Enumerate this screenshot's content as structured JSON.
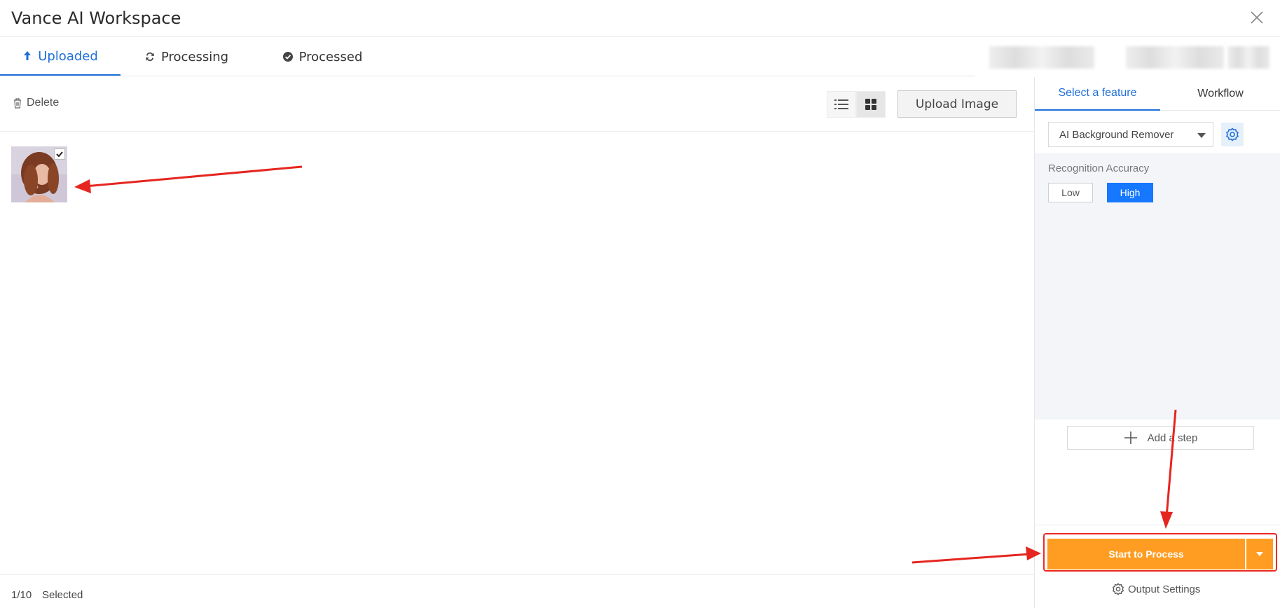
{
  "window": {
    "title": "Vance AI Workspace",
    "close_icon": "close-icon"
  },
  "tabs": [
    {
      "label": "Uploaded",
      "icon": "upload-arrow-icon",
      "active": true
    },
    {
      "label": "Processing",
      "icon": "refresh-icon",
      "active": false
    },
    {
      "label": "Processed",
      "icon": "check-circle-icon",
      "active": false
    }
  ],
  "toolbar": {
    "delete_label": "Delete",
    "upload_label": "Upload Image",
    "view_modes": [
      "list-view-icon",
      "grid-view-icon"
    ],
    "active_view": "grid"
  },
  "gallery": {
    "items": [
      {
        "selected": true,
        "thumbnail": "portrait-photo"
      }
    ]
  },
  "footer": {
    "count": "1/10",
    "selected_label": "Selected"
  },
  "panel": {
    "tabs": [
      "Select a feature",
      "Workflow"
    ],
    "feature_select": {
      "value": "AI Background Remover"
    },
    "accuracy": {
      "label": "Recognition Accuracy",
      "options": [
        "Low",
        "High"
      ],
      "selected": "High"
    },
    "add_step_label": "Add a step",
    "process_label": "Start to Process",
    "output_settings_label": "Output Settings"
  },
  "colors": {
    "accent_blue": "#1e6fd9",
    "selected_option": "#1677ff",
    "process_orange": "#ff9d22",
    "highlight_red": "#ee2a24"
  }
}
